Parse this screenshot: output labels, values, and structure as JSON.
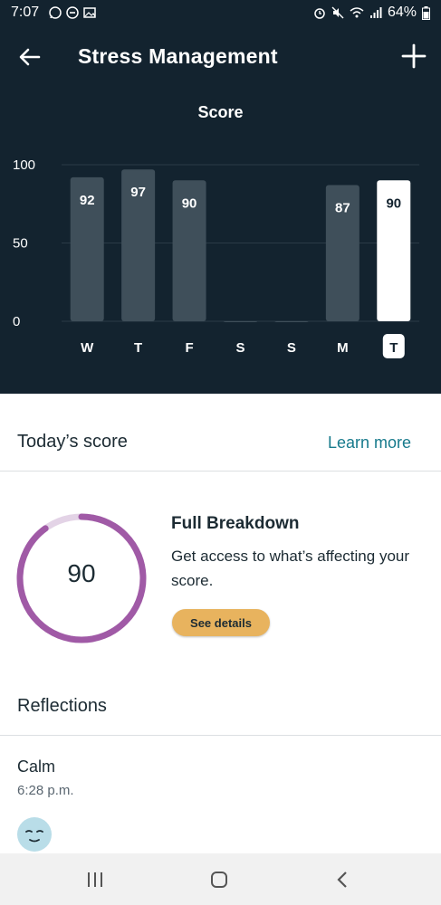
{
  "status_bar": {
    "time": "7:07",
    "battery": "64%",
    "left_icons": [
      "whatsapp-icon",
      "do-not-disturb-icon",
      "image-icon"
    ],
    "right_icons": [
      "alarm-icon",
      "mute-icon",
      "wifi-icon",
      "signal-icon",
      "battery-icon"
    ]
  },
  "app_bar": {
    "title": "Stress Management",
    "back_icon": "arrow-left-icon",
    "add_icon": "plus-icon"
  },
  "chart_data": {
    "type": "bar",
    "title": "Score",
    "categories": [
      "W",
      "T",
      "F",
      "S",
      "S",
      "M",
      "T"
    ],
    "values": [
      92,
      97,
      90,
      0,
      0,
      87,
      90
    ],
    "value_labels": [
      "92",
      "97",
      "90",
      "",
      "",
      "87",
      "90"
    ],
    "selected_index": 6,
    "ylim": [
      0,
      100
    ],
    "yticks": [
      0,
      50,
      100
    ],
    "grid": true,
    "colors": {
      "bar": "#3f4f5a",
      "selected_bar": "#ffffff",
      "background": "#13232f"
    }
  },
  "today": {
    "heading": "Today’s score",
    "learn_more": "Learn more",
    "score": "90",
    "score_value": 90,
    "ring_color": "#a05aa6",
    "ring_track_color": "#e3d3e6"
  },
  "breakdown": {
    "title": "Full Breakdown",
    "description": "Get access to what’s affecting your score.",
    "button_label": "See details",
    "button_color": "#e8b35e"
  },
  "reflections": {
    "heading": "Reflections",
    "items": [
      {
        "label": "Calm",
        "time": "6:28 p.m.",
        "icon": "calm-face-icon"
      }
    ]
  },
  "nav_bar": {
    "icons": [
      "recent-apps-icon",
      "home-icon",
      "back-nav-icon"
    ]
  }
}
